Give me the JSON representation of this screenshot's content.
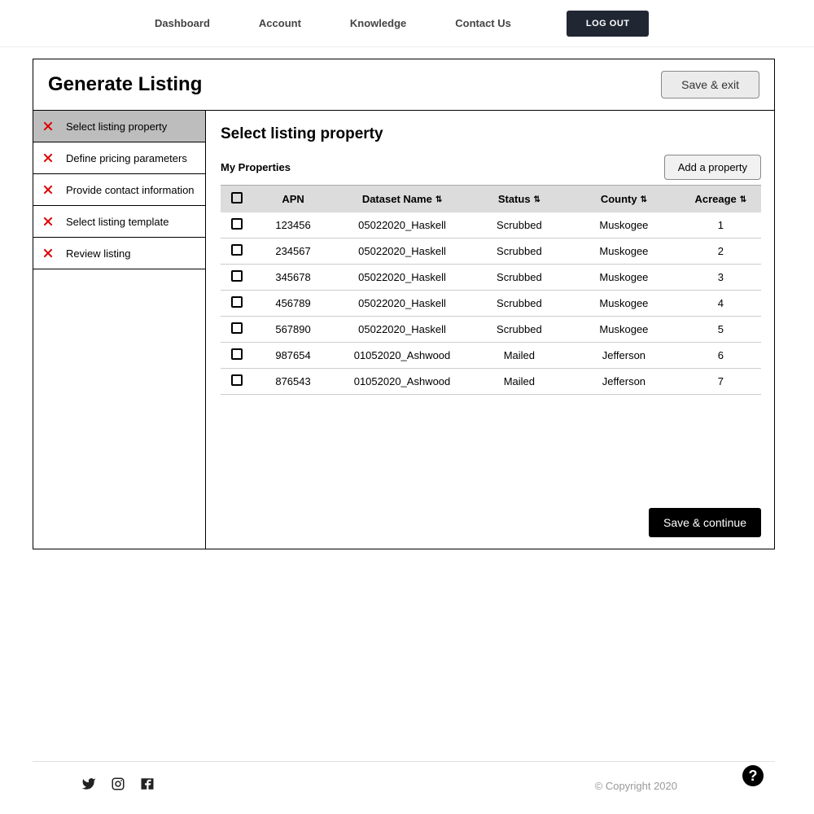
{
  "nav": {
    "items": [
      "Dashboard",
      "Account",
      "Knowledge",
      "Contact Us"
    ],
    "logout": "LOG OUT"
  },
  "header": {
    "title": "Generate Listing",
    "save_exit": "Save & exit"
  },
  "sidebar": {
    "items": [
      {
        "label": "Select listing property",
        "active": true
      },
      {
        "label": "Define pricing parameters",
        "active": false
      },
      {
        "label": "Provide contact information",
        "active": false
      },
      {
        "label": "Select listing template",
        "active": false
      },
      {
        "label": "Review listing",
        "active": false
      }
    ]
  },
  "content": {
    "title": "Select listing property",
    "subtitle": "My Properties",
    "add_property": "Add a property",
    "columns": {
      "apn": "APN",
      "dataset": "Dataset Name",
      "status": "Status",
      "county": "County",
      "acreage": "Acreage"
    },
    "rows": [
      {
        "apn": "123456",
        "dataset": "05022020_Haskell",
        "status": "Scrubbed",
        "county": "Muskogee",
        "acreage": "1"
      },
      {
        "apn": "234567",
        "dataset": "05022020_Haskell",
        "status": "Scrubbed",
        "county": "Muskogee",
        "acreage": "2"
      },
      {
        "apn": "345678",
        "dataset": "05022020_Haskell",
        "status": "Scrubbed",
        "county": "Muskogee",
        "acreage": "3"
      },
      {
        "apn": "456789",
        "dataset": "05022020_Haskell",
        "status": "Scrubbed",
        "county": "Muskogee",
        "acreage": "4"
      },
      {
        "apn": "567890",
        "dataset": "05022020_Haskell",
        "status": "Scrubbed",
        "county": "Muskogee",
        "acreage": "5"
      },
      {
        "apn": "987654",
        "dataset": "01052020_Ashwood",
        "status": "Mailed",
        "county": "Jefferson",
        "acreage": "6"
      },
      {
        "apn": "876543",
        "dataset": "01052020_Ashwood",
        "status": "Mailed",
        "county": "Jefferson",
        "acreage": "7"
      }
    ],
    "save_continue": "Save & continue"
  },
  "footer": {
    "copyright": "© Copyright 2020"
  }
}
